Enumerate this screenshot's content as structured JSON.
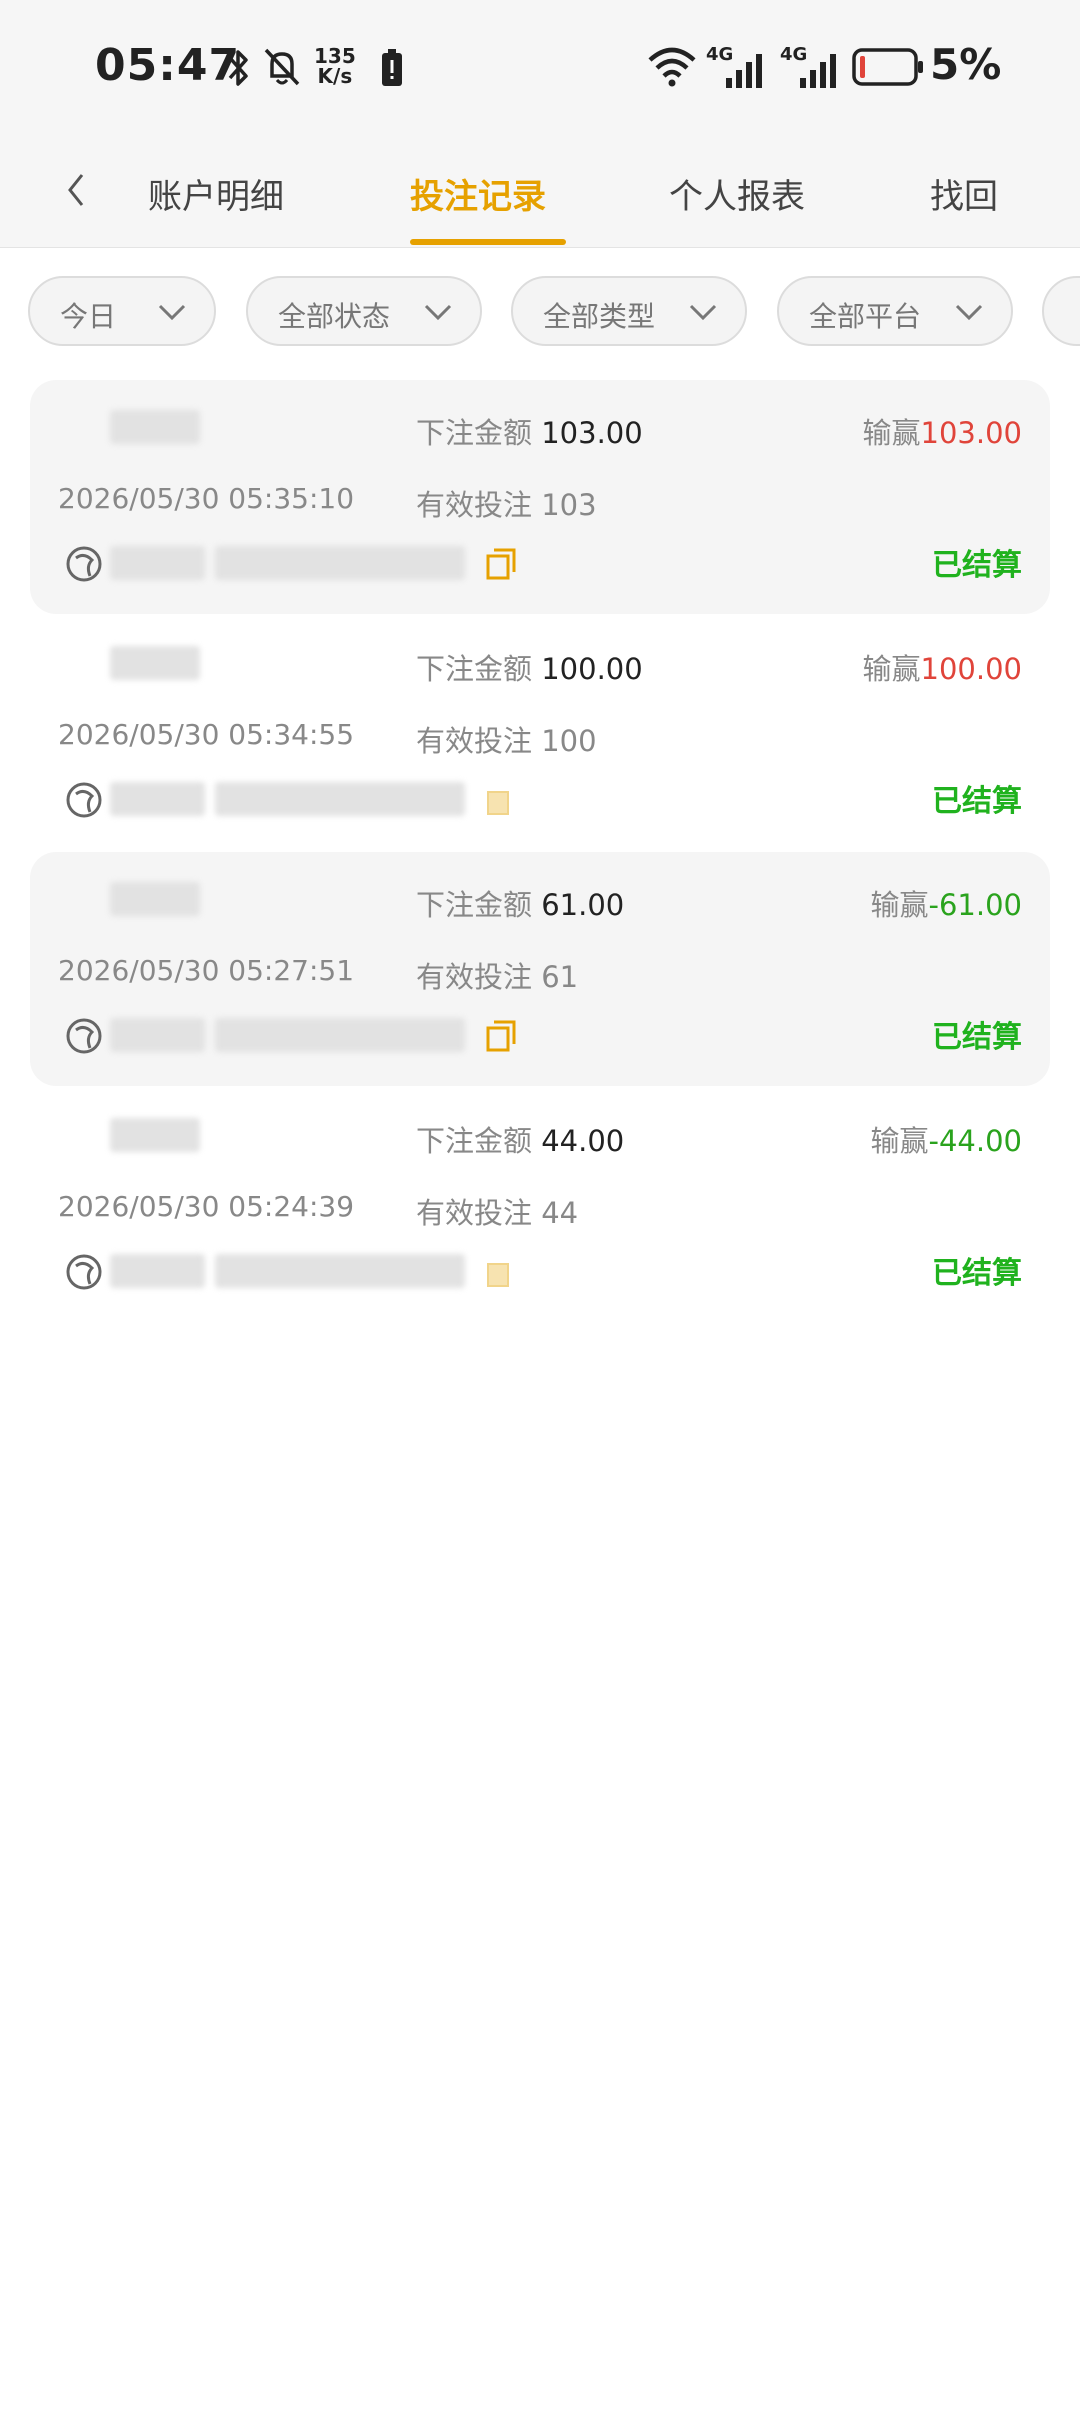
{
  "status_bar": {
    "time": "05:47",
    "speed_value": "135",
    "speed_unit": "K/s",
    "network_1": "4G",
    "network_2": "4G",
    "battery_percent": "5%"
  },
  "header": {
    "tabs": [
      {
        "label": "账户明细",
        "active": false
      },
      {
        "label": "投注记录",
        "active": true
      },
      {
        "label": "个人报表",
        "active": false
      },
      {
        "label": "找回",
        "active": false
      }
    ],
    "accent_color": "#e6a100"
  },
  "filters": [
    {
      "label": "今日"
    },
    {
      "label": "全部状态"
    },
    {
      "label": "全部类型"
    },
    {
      "label": "全部平台"
    }
  ],
  "records": [
    {
      "bet_label": "下注金额",
      "bet_amount": "103.00",
      "win_label": "输赢",
      "win_amount": "103.00",
      "win_sign": "positive",
      "time": "2026/05/30 05:35:10",
      "valid_label": "有效投注",
      "valid_amount": "103",
      "status": "已结算"
    },
    {
      "bet_label": "下注金额",
      "bet_amount": "100.00",
      "win_label": "输赢",
      "win_amount": "100.00",
      "win_sign": "positive",
      "time": "2026/05/30 05:34:55",
      "valid_label": "有效投注",
      "valid_amount": "100",
      "status": "已结算"
    },
    {
      "bet_label": "下注金额",
      "bet_amount": "61.00",
      "win_label": "输赢",
      "win_amount": "-61.00",
      "win_sign": "negative",
      "time": "2026/05/30 05:27:51",
      "valid_label": "有效投注",
      "valid_amount": "61",
      "status": "已结算"
    },
    {
      "bet_label": "下注金额",
      "bet_amount": "44.00",
      "win_label": "输赢",
      "win_amount": "-44.00",
      "win_sign": "negative",
      "time": "2026/05/30 05:24:39",
      "valid_label": "有效投注",
      "valid_amount": "44",
      "status": "已结算"
    }
  ],
  "colors": {
    "positive": "#e0443a",
    "negative": "#2aa31d",
    "settled": "#20b21e"
  }
}
